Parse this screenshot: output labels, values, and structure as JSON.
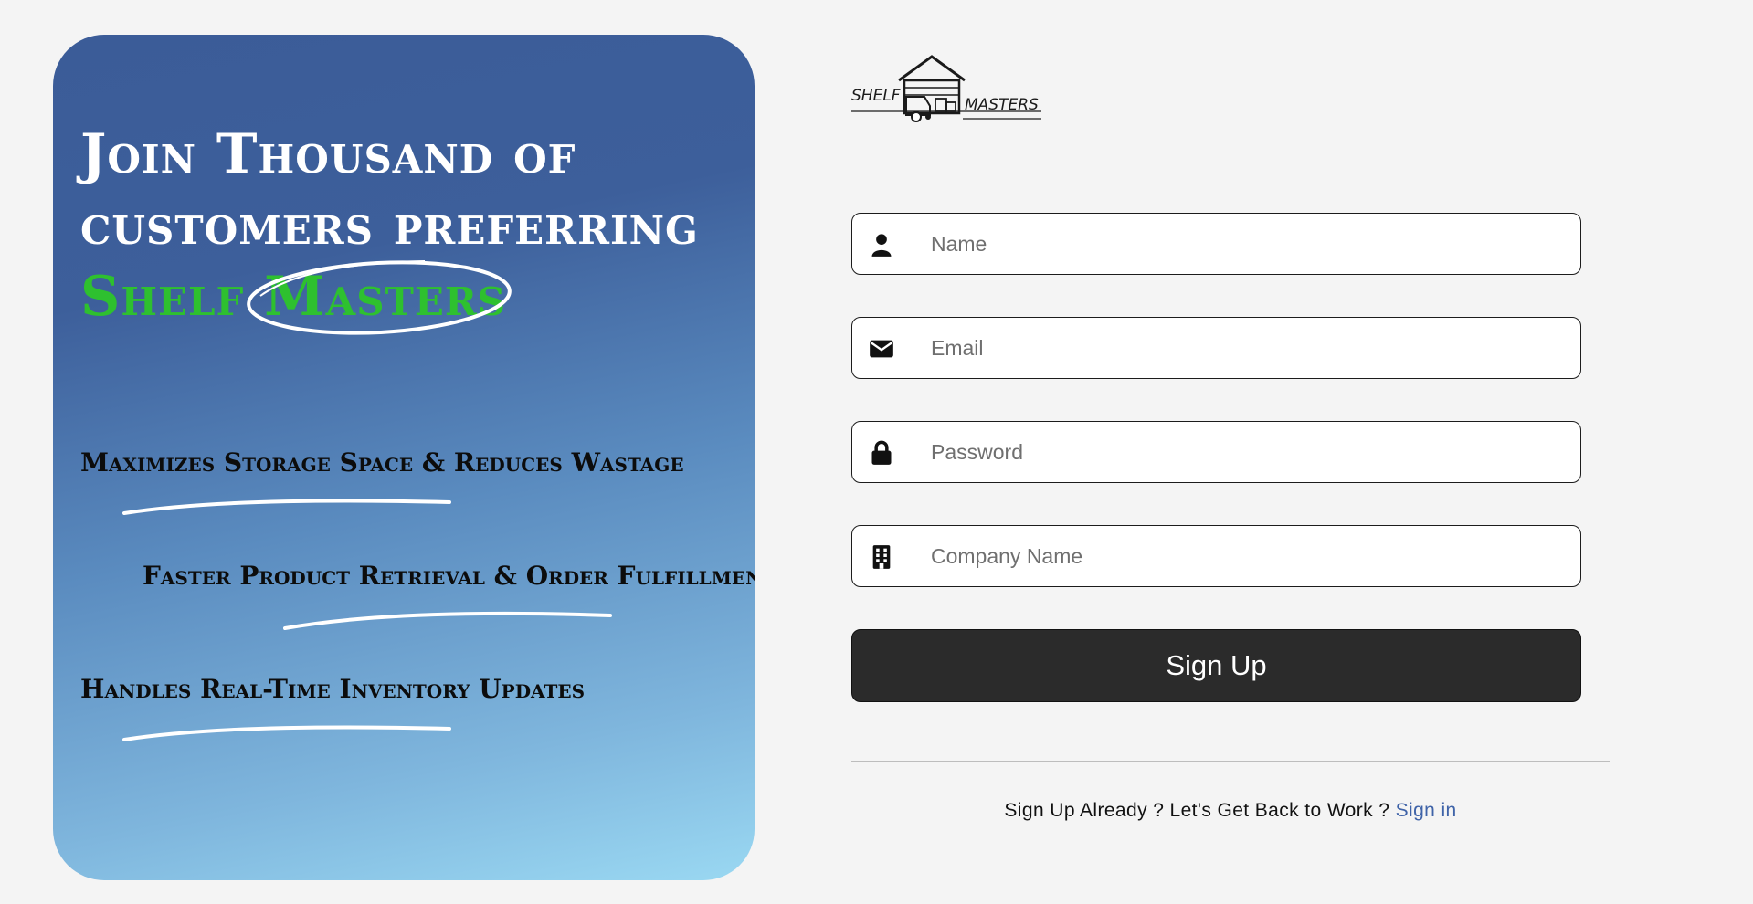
{
  "hero": {
    "title_line1": "Join Thousand of",
    "title_line2": "customers preferring",
    "brand_word1": "Shelf",
    "brand_word2": "Masters",
    "features": [
      "Maximizes Storage Space & Reduces Wastage",
      "Faster Product Retrieval & Order Fulfillment",
      "Handles Real-Time Inventory Updates"
    ]
  },
  "logo": {
    "text_left": "SHELF",
    "text_right": "MASTERS"
  },
  "form": {
    "fields": [
      {
        "placeholder": "Name",
        "icon": "user-icon"
      },
      {
        "placeholder": "Email",
        "icon": "envelope-icon"
      },
      {
        "placeholder": "Password",
        "icon": "lock-icon"
      },
      {
        "placeholder": "Company Name",
        "icon": "building-icon"
      }
    ],
    "submit_label": "Sign Up"
  },
  "footer": {
    "prompt": "Sign Up Already ? Let's Get Back to Work ?",
    "link": "Sign in"
  },
  "colors": {
    "brand_green": "#2ec02f",
    "link_blue": "#3f63a8",
    "button_dark": "#2b2b2b"
  }
}
